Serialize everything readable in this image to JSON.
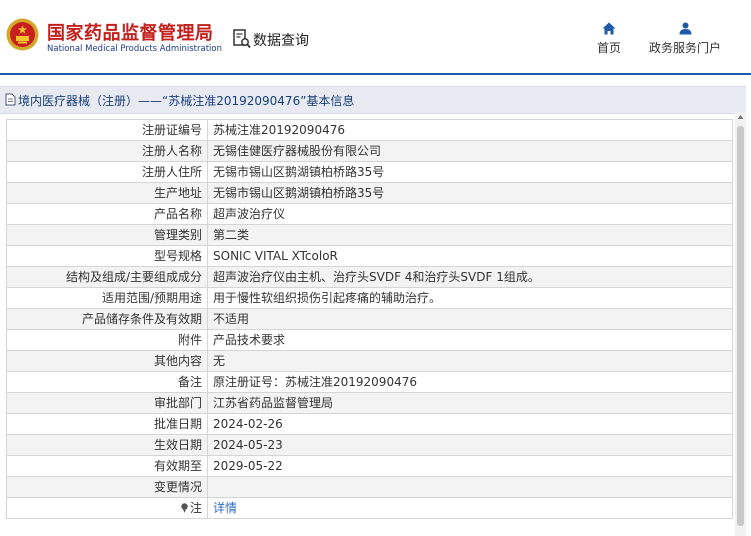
{
  "header": {
    "brand_cn": "国家药品监督管理局",
    "brand_en": "National Medical Products Administration",
    "query_label": "数据查询",
    "nav": {
      "home": "首页",
      "portal": "政务服务门户"
    }
  },
  "breadcrumb": "境内医疗器械（注册）——“苏械注准20192090476”基本信息",
  "rows": [
    {
      "key": "注册证编号",
      "value": "苏械注准20192090476"
    },
    {
      "key": "注册人名称",
      "value": "无锡佳健医疗器械股份有限公司"
    },
    {
      "key": "注册人住所",
      "value": "无锡市锡山区鹅湖镇柏桥路35号"
    },
    {
      "key": "生产地址",
      "value": "无锡市锡山区鹅湖镇柏桥路35号"
    },
    {
      "key": "产品名称",
      "value": "超声波治疗仪"
    },
    {
      "key": "管理类别",
      "value": "第二类"
    },
    {
      "key": "型号规格",
      "value": "SONIC VITAL XTcoloR"
    },
    {
      "key": "结构及组成/主要组成成分",
      "value": "超声波治疗仪由主机、治疗头SVDF 4和治疗头SVDF 1组成。"
    },
    {
      "key": "适用范围/预期用途",
      "value": "用于慢性软组织损伤引起疼痛的辅助治疗。"
    },
    {
      "key": "产品储存条件及有效期",
      "value": "不适用"
    },
    {
      "key": "附件",
      "value": "产品技术要求"
    },
    {
      "key": "其他内容",
      "value": "无"
    },
    {
      "key": "备注",
      "value": "原注册证号：苏械注准20192090476"
    },
    {
      "key": "审批部门",
      "value": "江苏省药品监督管理局"
    },
    {
      "key": "批准日期",
      "value": "2024-02-26"
    },
    {
      "key": "生效日期",
      "value": "2024-05-23"
    },
    {
      "key": "有效期至",
      "value": "2029-05-22"
    },
    {
      "key": "变更情况",
      "value": ""
    },
    {
      "key": "注",
      "value": "详情"
    }
  ],
  "colors": {
    "brand_red": "#c2201d",
    "nav_blue": "#1e5aa8",
    "link_blue": "#2b6bc4"
  }
}
